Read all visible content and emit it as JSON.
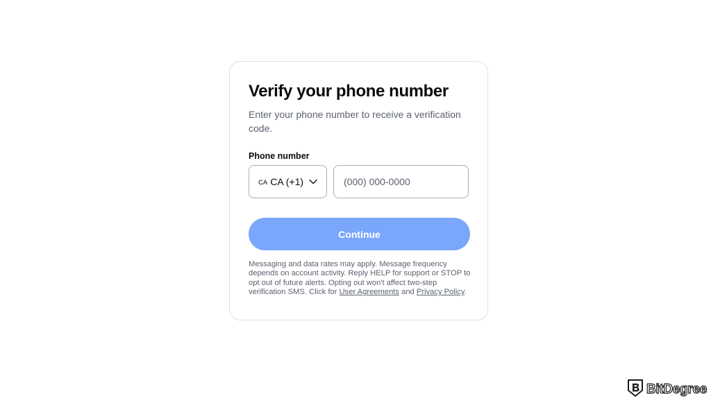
{
  "card": {
    "title": "Verify your phone number",
    "subtitle": "Enter your phone number to receive a verification code.",
    "phone_label": "Phone number",
    "country": {
      "flag": "CA",
      "selected": "CA (+1)"
    },
    "phone_input": {
      "placeholder": "(000) 000-0000",
      "value": ""
    },
    "continue_label": "Continue",
    "disclaimer": {
      "text": "Messaging and data rates may apply. Message frequency depends on account activity. Reply HELP for support or STOP to opt out of future alerts. Opting out won't affect two-step verification SMS. Click for ",
      "link1": "User Agreements",
      "and": " and ",
      "link2": "Privacy Policy",
      "end": "."
    }
  },
  "watermark": {
    "text": "BitDegree"
  },
  "colors": {
    "button": "#7aa7fb",
    "text_primary": "#0a0b0d",
    "text_secondary": "#5b616e",
    "border": "#dcdfe4"
  }
}
